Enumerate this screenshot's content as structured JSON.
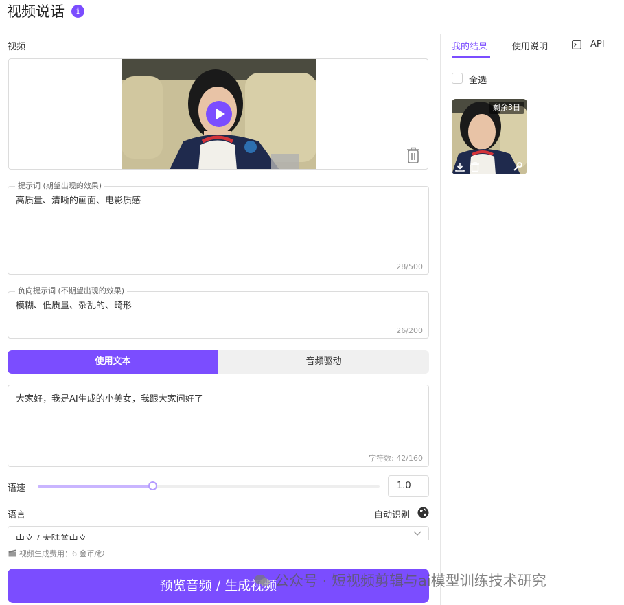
{
  "header": {
    "title": "视频说话",
    "info_icon": "i"
  },
  "video_section": {
    "label": "视频"
  },
  "prompt": {
    "legend": "提示词 (期望出现的效果)",
    "value": "高质量、清晰的画面、电影质感",
    "counter": "28/500"
  },
  "negative_prompt": {
    "legend": "负向提示词 (不期望出现的效果)",
    "value": "模糊、低质量、杂乱的、畸形",
    "counter": "26/200"
  },
  "mode_tabs": {
    "text_label": "使用文本",
    "audio_label": "音频驱动"
  },
  "speech_text": {
    "value": "大家好，我是AI生成的小美女，我跟大家问好了",
    "counter": "字符数: 42/160"
  },
  "speed": {
    "label": "语速",
    "value": "1.0",
    "fraction": 0.335
  },
  "language": {
    "label": "语言",
    "auto_detect": "自动识别",
    "selected": "中文 / 大陆普中文"
  },
  "cost": {
    "text": "视频生成费用：6 金币/秒"
  },
  "generate_button": {
    "label": "预览音频 / 生成视频"
  },
  "right_panel": {
    "tabs": [
      {
        "label": "我的结果",
        "active": true
      },
      {
        "label": "使用说明",
        "active": false
      },
      {
        "label": "API",
        "active": false
      }
    ],
    "select_all": "全选",
    "result_badge": "剩余3日"
  },
  "watermark": {
    "text": "公众号 · 短视频剪辑与ai模型训练技术研究"
  },
  "colors": {
    "accent": "#7b4dff",
    "slider_fill": "#c9b5ff",
    "tab_bg": "#f0f0f0"
  },
  "icons": [
    "info-icon",
    "play-icon",
    "trash-icon",
    "globe-icon",
    "chevron-down-icon",
    "clapper-icon",
    "terminal-icon",
    "download-icon",
    "wrench-icon",
    "wechat-icon"
  ]
}
